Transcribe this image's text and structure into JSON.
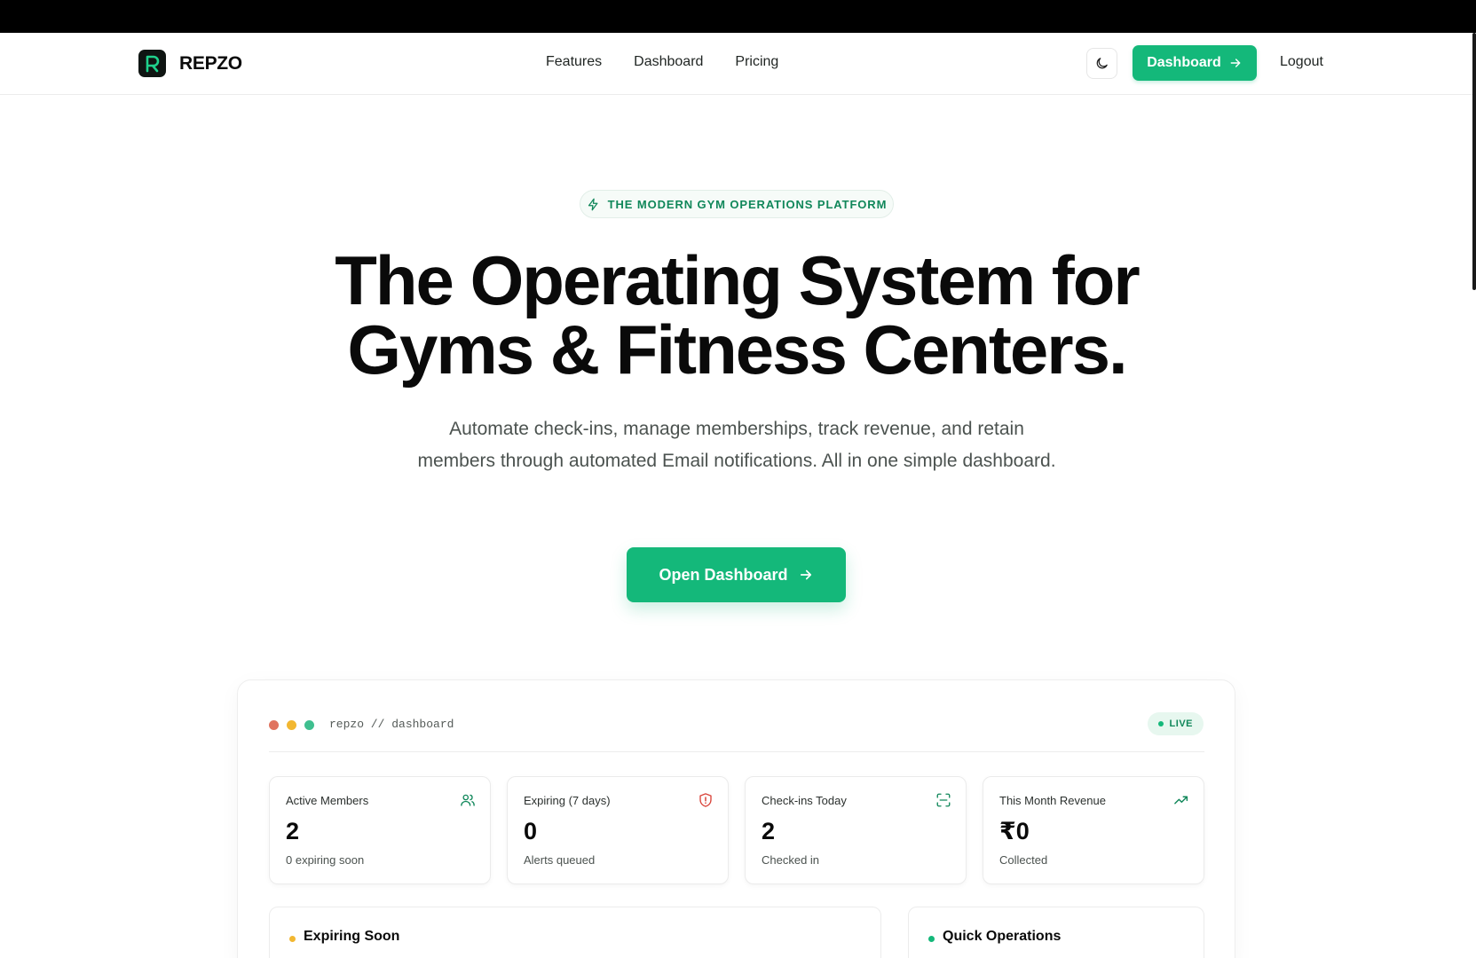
{
  "brand": {
    "name": "REPZO",
    "logo_letter": "R"
  },
  "nav": {
    "links": [
      "Features",
      "Dashboard",
      "Pricing"
    ],
    "dashboard_button": "Dashboard",
    "logout": "Logout"
  },
  "hero": {
    "badge": "THE MODERN GYM OPERATIONS PLATFORM",
    "title_line1": "The Operating System for",
    "title_line2": "Gyms & Fitness Centers.",
    "subtitle": "Automate check-ins, manage memberships, track revenue, and retain members through automated Email notifications. All in one simple dashboard.",
    "cta": "Open Dashboard"
  },
  "preview": {
    "window_title": "repzo // dashboard",
    "status": "LIVE",
    "stats": [
      {
        "label": "Active Members",
        "value": "2",
        "note": "0 expiring soon",
        "icon": "users-icon"
      },
      {
        "label": "Expiring (7 days)",
        "value": "0",
        "note": "Alerts queued",
        "icon": "shield-alert-icon"
      },
      {
        "label": "Check-ins Today",
        "value": "2",
        "note": "Checked in",
        "icon": "scan-icon"
      },
      {
        "label": "This Month Revenue",
        "value": "₹0",
        "note": "Collected",
        "icon": "trending-up-icon"
      }
    ],
    "panels": [
      {
        "title": "Expiring Soon"
      },
      {
        "title": "Quick Operations"
      }
    ]
  },
  "colors": {
    "accent": "#14b87a",
    "accent_text": "#10875a",
    "dot_red": "#e0735f",
    "dot_yellow": "#f2b731",
    "dot_green": "#3fbf8f",
    "alert_red": "#d9443a"
  }
}
